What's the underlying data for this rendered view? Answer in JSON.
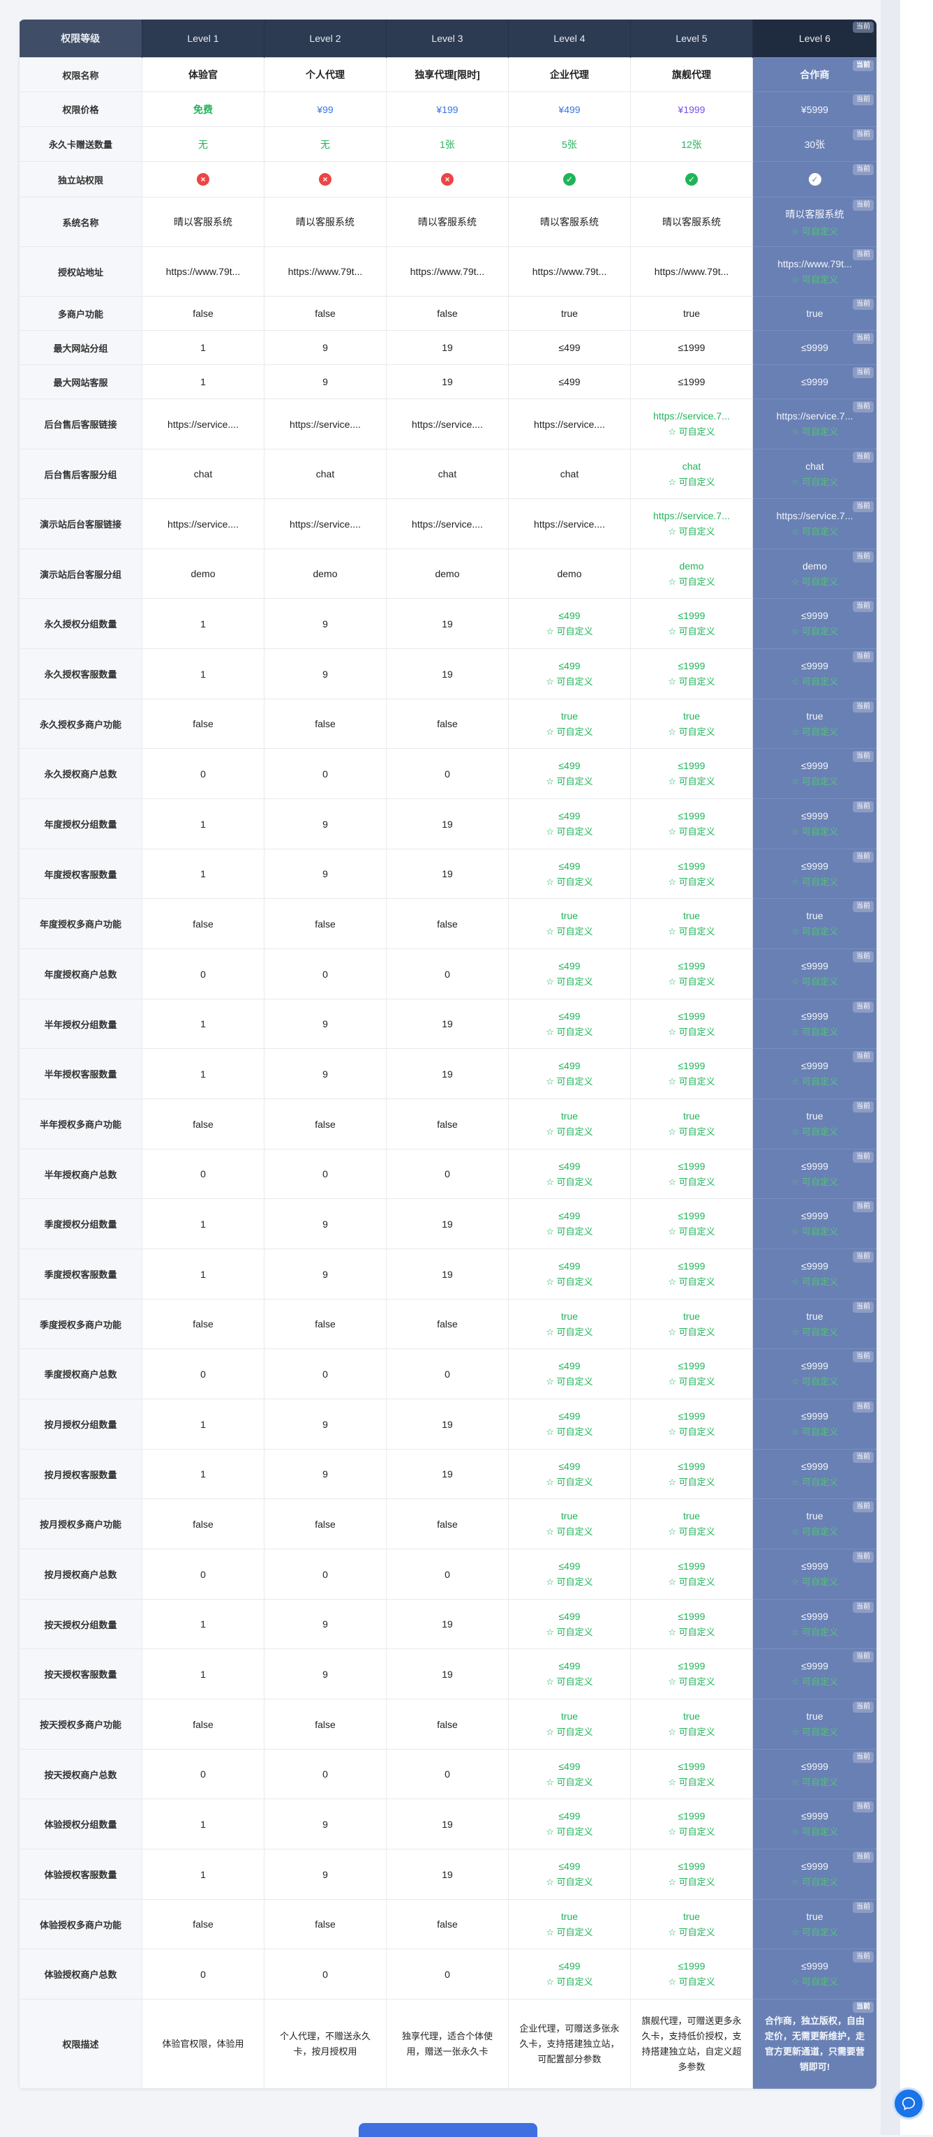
{
  "header": {
    "label_col": "权限等级",
    "levels": [
      "Level 1",
      "Level 2",
      "Level 3",
      "Level 4",
      "Level 5",
      "Level 6"
    ],
    "current_tag": "当前"
  },
  "custom_label": "☆ 可自定义",
  "rows": [
    {
      "label": "权限名称",
      "cells": [
        "体验官",
        "个人代理",
        "独享代理[限时]",
        "企业代理",
        "旗舰代理",
        "合作商"
      ],
      "style": "name"
    },
    {
      "label": "权限价格",
      "cells": [
        "免费",
        "¥99",
        "¥199",
        "¥499",
        "¥1999",
        "¥5999"
      ],
      "style": "price"
    },
    {
      "label": "永久卡赠送数量",
      "cells": [
        "无",
        "无",
        "1张",
        "5张",
        "12张",
        "30张"
      ],
      "style": "gift"
    },
    {
      "label": "独立站权限",
      "cells": [
        "no",
        "no",
        "no",
        "yes",
        "yes",
        "yes"
      ],
      "style": "icon"
    },
    {
      "label": "系统名称",
      "cells": [
        "晴以客服系统",
        "晴以客服系统",
        "晴以客服系统",
        "晴以客服系统",
        "晴以客服系统",
        "晴以客服系统"
      ],
      "custom": [
        0,
        0,
        0,
        0,
        0,
        1
      ]
    },
    {
      "label": "授权站地址",
      "cells": [
        "https://www.79t...",
        "https://www.79t...",
        "https://www.79t...",
        "https://www.79t...",
        "https://www.79t...",
        "https://www.79t..."
      ],
      "custom": [
        0,
        0,
        0,
        0,
        0,
        1
      ]
    },
    {
      "label": "多商户功能",
      "cells": [
        "false",
        "false",
        "false",
        "true",
        "true",
        "true"
      ],
      "custom": [
        0,
        0,
        0,
        0,
        0,
        0
      ]
    },
    {
      "label": "最大网站分组",
      "cells": [
        "1",
        "9",
        "19",
        "≤499",
        "≤1999",
        "≤9999"
      ],
      "custom": [
        0,
        0,
        0,
        0,
        0,
        0
      ]
    },
    {
      "label": "最大网站客服",
      "cells": [
        "1",
        "9",
        "19",
        "≤499",
        "≤1999",
        "≤9999"
      ],
      "custom": [
        0,
        0,
        0,
        0,
        0,
        0
      ]
    },
    {
      "label": "后台售后客服链接",
      "cells": [
        "https://service....",
        "https://service....",
        "https://service....",
        "https://service....",
        "https://service.7...",
        "https://service.7..."
      ],
      "custom": [
        0,
        0,
        0,
        0,
        1,
        1
      ]
    },
    {
      "label": "后台售后客服分组",
      "cells": [
        "chat",
        "chat",
        "chat",
        "chat",
        "chat",
        "chat"
      ],
      "custom": [
        0,
        0,
        0,
        0,
        1,
        1
      ]
    },
    {
      "label": "演示站后台客服链接",
      "cells": [
        "https://service....",
        "https://service....",
        "https://service....",
        "https://service....",
        "https://service.7...",
        "https://service.7..."
      ],
      "custom": [
        0,
        0,
        0,
        0,
        1,
        1
      ]
    },
    {
      "label": "演示站后台客服分组",
      "cells": [
        "demo",
        "demo",
        "demo",
        "demo",
        "demo",
        "demo"
      ],
      "custom": [
        0,
        0,
        0,
        0,
        1,
        1
      ]
    },
    {
      "label": "永久授权分组数量",
      "cells": [
        "1",
        "9",
        "19",
        "≤499",
        "≤1999",
        "≤9999"
      ],
      "custom": [
        0,
        0,
        0,
        1,
        1,
        1
      ]
    },
    {
      "label": "永久授权客服数量",
      "cells": [
        "1",
        "9",
        "19",
        "≤499",
        "≤1999",
        "≤9999"
      ],
      "custom": [
        0,
        0,
        0,
        1,
        1,
        1
      ]
    },
    {
      "label": "永久授权多商户功能",
      "cells": [
        "false",
        "false",
        "false",
        "true",
        "true",
        "true"
      ],
      "custom": [
        0,
        0,
        0,
        1,
        1,
        1
      ]
    },
    {
      "label": "永久授权商户总数",
      "cells": [
        "0",
        "0",
        "0",
        "≤499",
        "≤1999",
        "≤9999"
      ],
      "custom": [
        0,
        0,
        0,
        1,
        1,
        1
      ]
    },
    {
      "label": "年度授权分组数量",
      "cells": [
        "1",
        "9",
        "19",
        "≤499",
        "≤1999",
        "≤9999"
      ],
      "custom": [
        0,
        0,
        0,
        1,
        1,
        1
      ]
    },
    {
      "label": "年度授权客服数量",
      "cells": [
        "1",
        "9",
        "19",
        "≤499",
        "≤1999",
        "≤9999"
      ],
      "custom": [
        0,
        0,
        0,
        1,
        1,
        1
      ]
    },
    {
      "label": "年度授权多商户功能",
      "cells": [
        "false",
        "false",
        "false",
        "true",
        "true",
        "true"
      ],
      "custom": [
        0,
        0,
        0,
        1,
        1,
        1
      ]
    },
    {
      "label": "年度授权商户总数",
      "cells": [
        "0",
        "0",
        "0",
        "≤499",
        "≤1999",
        "≤9999"
      ],
      "custom": [
        0,
        0,
        0,
        1,
        1,
        1
      ]
    },
    {
      "label": "半年授权分组数量",
      "cells": [
        "1",
        "9",
        "19",
        "≤499",
        "≤1999",
        "≤9999"
      ],
      "custom": [
        0,
        0,
        0,
        1,
        1,
        1
      ]
    },
    {
      "label": "半年授权客服数量",
      "cells": [
        "1",
        "9",
        "19",
        "≤499",
        "≤1999",
        "≤9999"
      ],
      "custom": [
        0,
        0,
        0,
        1,
        1,
        1
      ]
    },
    {
      "label": "半年授权多商户功能",
      "cells": [
        "false",
        "false",
        "false",
        "true",
        "true",
        "true"
      ],
      "custom": [
        0,
        0,
        0,
        1,
        1,
        1
      ]
    },
    {
      "label": "半年授权商户总数",
      "cells": [
        "0",
        "0",
        "0",
        "≤499",
        "≤1999",
        "≤9999"
      ],
      "custom": [
        0,
        0,
        0,
        1,
        1,
        1
      ]
    },
    {
      "label": "季度授权分组数量",
      "cells": [
        "1",
        "9",
        "19",
        "≤499",
        "≤1999",
        "≤9999"
      ],
      "custom": [
        0,
        0,
        0,
        1,
        1,
        1
      ]
    },
    {
      "label": "季度授权客服数量",
      "cells": [
        "1",
        "9",
        "19",
        "≤499",
        "≤1999",
        "≤9999"
      ],
      "custom": [
        0,
        0,
        0,
        1,
        1,
        1
      ]
    },
    {
      "label": "季度授权多商户功能",
      "cells": [
        "false",
        "false",
        "false",
        "true",
        "true",
        "true"
      ],
      "custom": [
        0,
        0,
        0,
        1,
        1,
        1
      ]
    },
    {
      "label": "季度授权商户总数",
      "cells": [
        "0",
        "0",
        "0",
        "≤499",
        "≤1999",
        "≤9999"
      ],
      "custom": [
        0,
        0,
        0,
        1,
        1,
        1
      ]
    },
    {
      "label": "按月授权分组数量",
      "cells": [
        "1",
        "9",
        "19",
        "≤499",
        "≤1999",
        "≤9999"
      ],
      "custom": [
        0,
        0,
        0,
        1,
        1,
        1
      ]
    },
    {
      "label": "按月授权客服数量",
      "cells": [
        "1",
        "9",
        "19",
        "≤499",
        "≤1999",
        "≤9999"
      ],
      "custom": [
        0,
        0,
        0,
        1,
        1,
        1
      ]
    },
    {
      "label": "按月授权多商户功能",
      "cells": [
        "false",
        "false",
        "false",
        "true",
        "true",
        "true"
      ],
      "custom": [
        0,
        0,
        0,
        1,
        1,
        1
      ]
    },
    {
      "label": "按月授权商户总数",
      "cells": [
        "0",
        "0",
        "0",
        "≤499",
        "≤1999",
        "≤9999"
      ],
      "custom": [
        0,
        0,
        0,
        1,
        1,
        1
      ]
    },
    {
      "label": "按天授权分组数量",
      "cells": [
        "1",
        "9",
        "19",
        "≤499",
        "≤1999",
        "≤9999"
      ],
      "custom": [
        0,
        0,
        0,
        1,
        1,
        1
      ]
    },
    {
      "label": "按天授权客服数量",
      "cells": [
        "1",
        "9",
        "19",
        "≤499",
        "≤1999",
        "≤9999"
      ],
      "custom": [
        0,
        0,
        0,
        1,
        1,
        1
      ]
    },
    {
      "label": "按天授权多商户功能",
      "cells": [
        "false",
        "false",
        "false",
        "true",
        "true",
        "true"
      ],
      "custom": [
        0,
        0,
        0,
        1,
        1,
        1
      ]
    },
    {
      "label": "按天授权商户总数",
      "cells": [
        "0",
        "0",
        "0",
        "≤499",
        "≤1999",
        "≤9999"
      ],
      "custom": [
        0,
        0,
        0,
        1,
        1,
        1
      ]
    },
    {
      "label": "体验授权分组数量",
      "cells": [
        "1",
        "9",
        "19",
        "≤499",
        "≤1999",
        "≤9999"
      ],
      "custom": [
        0,
        0,
        0,
        1,
        1,
        1
      ]
    },
    {
      "label": "体验授权客服数量",
      "cells": [
        "1",
        "9",
        "19",
        "≤499",
        "≤1999",
        "≤9999"
      ],
      "custom": [
        0,
        0,
        0,
        1,
        1,
        1
      ]
    },
    {
      "label": "体验授权多商户功能",
      "cells": [
        "false",
        "false",
        "false",
        "true",
        "true",
        "true"
      ],
      "custom": [
        0,
        0,
        0,
        1,
        1,
        1
      ]
    },
    {
      "label": "体验授权商户总数",
      "cells": [
        "0",
        "0",
        "0",
        "≤499",
        "≤1999",
        "≤9999"
      ],
      "custom": [
        0,
        0,
        0,
        1,
        1,
        1
      ]
    },
    {
      "label": "权限描述",
      "cells": [
        "体验官权限，体验用",
        "个人代理，不赠送永久卡，按月授权用",
        "独享代理，适合个体使用，赠送一张永久卡",
        "企业代理，可赠送多张永久卡，支持搭建独立站，可配置部分参数",
        "旗舰代理，可赠送更多永久卡，支持低价授权，支持搭建独立站，自定义超多参数",
        "合作商，独立版权，自由定价，无需更新维护，走官方更新通道，只需要营销即可!"
      ],
      "style": "desc"
    }
  ],
  "colors": {
    "current_col": "#6980b4",
    "header": "#2c3a52",
    "green": "#22b35a",
    "blue": "#3b74e0",
    "purple": "#7a4fe6",
    "red": "#ee4444"
  }
}
